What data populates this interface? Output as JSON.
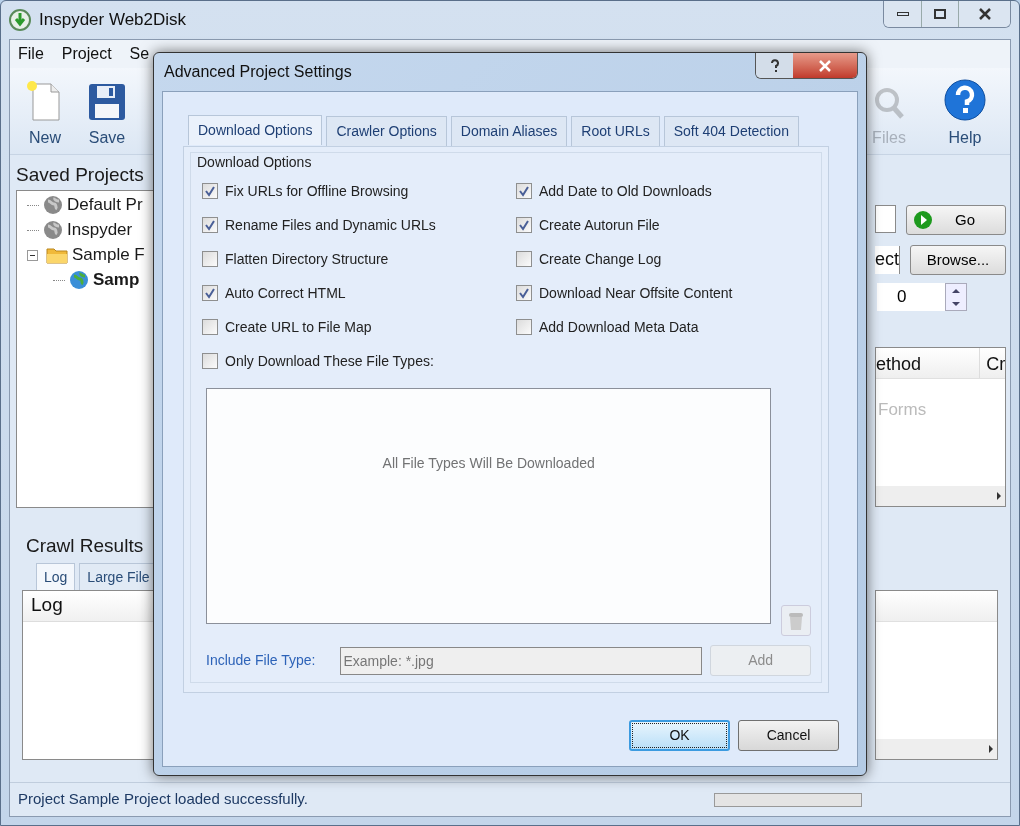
{
  "window": {
    "title": "Inspyder Web2Disk"
  },
  "menu": [
    "File",
    "Project",
    "Se"
  ],
  "toolbar_left": [
    {
      "label": "New",
      "kind": "new",
      "disabled": false
    },
    {
      "label": "Save",
      "kind": "save",
      "disabled": false
    }
  ],
  "toolbar_right": [
    {
      "label": "Files",
      "kind": "files",
      "disabled": true
    },
    {
      "label": "Help",
      "kind": "help",
      "disabled": false
    }
  ],
  "saved_projects": {
    "title": "Saved Projects",
    "tree": [
      {
        "label": "Default Pr",
        "kind": "project",
        "current": false
      },
      {
        "label": "Inspyder",
        "kind": "project",
        "current": false
      },
      {
        "label": "Sample F",
        "kind": "folder",
        "expanded": true,
        "children": [
          {
            "label": "Samp",
            "kind": "project",
            "current": true
          }
        ]
      }
    ]
  },
  "crawl_results": {
    "title": "Crawl Results",
    "tabs": [
      {
        "label": "Log",
        "selected": true
      },
      {
        "label": "Large File",
        "selected": false
      }
    ],
    "log_column": "Log"
  },
  "project_panel": {
    "go_button": "Go",
    "label_fragment": "ect",
    "browse_button": "Browse...",
    "spinner_value": "0",
    "table_columns": [
      "ethod",
      "Cr"
    ],
    "table_placeholder": "Forms"
  },
  "status_bar": {
    "message": "Project Sample Project loaded successfully."
  },
  "dialog": {
    "title": "Advanced Project Settings",
    "tabs": [
      {
        "label": "Download Options",
        "selected": true
      },
      {
        "label": "Crawler Options",
        "selected": false
      },
      {
        "label": "Domain Aliases",
        "selected": false
      },
      {
        "label": "Root URLs",
        "selected": false
      },
      {
        "label": "Soft 404 Detection",
        "selected": false
      }
    ],
    "group_title": "Download Options",
    "options": [
      {
        "label": "Fix URLs for Offline Browsing",
        "checked": true
      },
      {
        "label": "Add Date to Old Downloads",
        "checked": true
      },
      {
        "label": "Rename Files and Dynamic URLs",
        "checked": true
      },
      {
        "label": "Create Autorun File",
        "checked": true
      },
      {
        "label": "Flatten Directory Structure",
        "checked": false
      },
      {
        "label": "Create Change Log",
        "checked": false
      },
      {
        "label": "Auto Correct HTML",
        "checked": true
      },
      {
        "label": "Download Near Offsite Content",
        "checked": true
      },
      {
        "label": "Create URL to File Map",
        "checked": false
      },
      {
        "label": "Add Download Meta Data",
        "checked": false
      }
    ],
    "file_types_filter": {
      "label": "Only Download These File Types:",
      "checked": false
    },
    "list_placeholder": "All File Types Will Be Downloaded",
    "include_label": "Include File Type:",
    "include_placeholder": "Example: *.jpg",
    "add_button": {
      "label": "Add",
      "disabled": true
    },
    "buttons": [
      {
        "label": "OK",
        "default": true
      },
      {
        "label": "Cancel",
        "default": false
      }
    ]
  }
}
